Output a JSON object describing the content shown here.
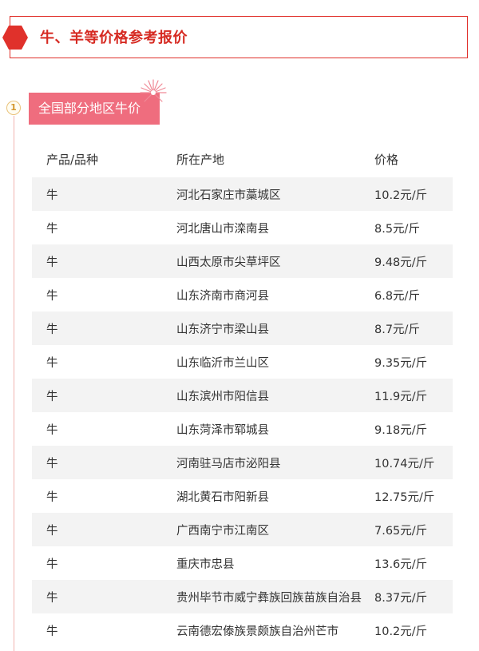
{
  "header": {
    "title": "牛、羊等价格参考报价",
    "accent_color": "#e0312b"
  },
  "section": {
    "number": "1",
    "label": "全国部分地区牛价",
    "label_color": "#ef6d7e"
  },
  "table": {
    "columns": [
      "产品/品种",
      "所在产地",
      "价格"
    ],
    "rows": [
      [
        "牛",
        "河北石家庄市藁城区",
        "10.2元/斤"
      ],
      [
        "牛",
        "河北唐山市滦南县",
        "8.5元/斤"
      ],
      [
        "牛",
        "山西太原市尖草坪区",
        "9.48元/斤"
      ],
      [
        "牛",
        "山东济南市商河县",
        "6.8元/斤"
      ],
      [
        "牛",
        "山东济宁市梁山县",
        "8.7元/斤"
      ],
      [
        "牛",
        "山东临沂市兰山区",
        "9.35元/斤"
      ],
      [
        "牛",
        "山东滨州市阳信县",
        "11.9元/斤"
      ],
      [
        "牛",
        "山东菏泽市郓城县",
        "9.18元/斤"
      ],
      [
        "牛",
        "河南驻马店市泌阳县",
        "10.74元/斤"
      ],
      [
        "牛",
        "湖北黄石市阳新县",
        "12.75元/斤"
      ],
      [
        "牛",
        "广西南宁市江南区",
        "7.65元/斤"
      ],
      [
        "牛",
        "重庆市忠县",
        "13.6元/斤"
      ],
      [
        "牛",
        "贵州毕节市威宁彝族回族苗族自治县",
        "8.37元/斤"
      ],
      [
        "牛",
        "云南德宏傣族景颇族自治州芒市",
        "10.2元/斤"
      ]
    ]
  }
}
